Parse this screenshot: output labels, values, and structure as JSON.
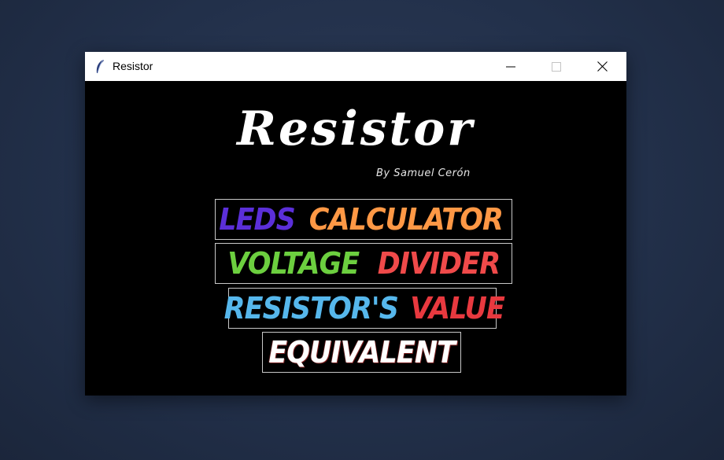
{
  "window": {
    "title": "Resistor",
    "icon": "feather-icon",
    "controls": [
      "minimize-icon",
      "maximize-icon",
      "close-icon"
    ]
  },
  "header": {
    "app_title": "Resistor",
    "byline": "By Samuel Cerón"
  },
  "menu": [
    {
      "words": [
        "LEDS",
        "CALCULATOR"
      ],
      "colors": [
        "#5b2fd9",
        "#ff9845"
      ]
    },
    {
      "words": [
        "VOLTAGE",
        "DIVIDER"
      ],
      "colors": [
        "#6ccf3f",
        "#f04a4a"
      ]
    },
    {
      "words": [
        "RESISTOR'S",
        "VALUE"
      ],
      "colors": [
        "#56b7ec",
        "#e8393f"
      ]
    },
    {
      "words": [
        "EQUIVALENT"
      ],
      "colors": [
        "#ffffff"
      ]
    }
  ],
  "colors": {
    "desktop_background": "#22304a",
    "window_background": "#000000",
    "titlebar_background": "#ffffff",
    "button_border": "#c8c8c8"
  }
}
